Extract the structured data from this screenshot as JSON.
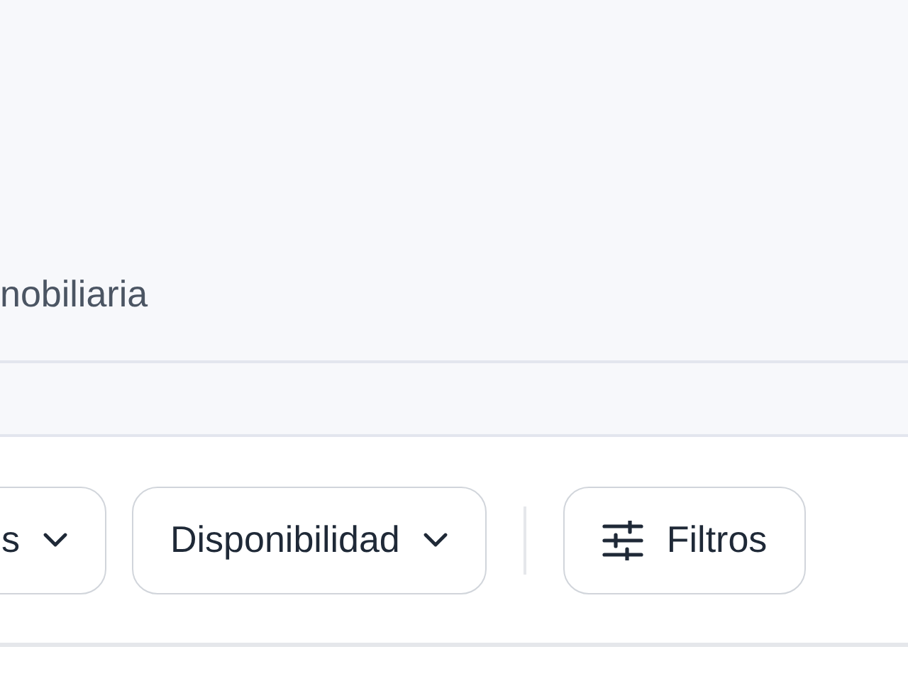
{
  "header": {
    "subtitle": "nobiliaria"
  },
  "filters": [
    {
      "kind": "dropdown",
      "label": "s"
    },
    {
      "kind": "dropdown",
      "label": "Disponibilidad"
    },
    {
      "kind": "panel",
      "label": "Filtros"
    }
  ]
}
